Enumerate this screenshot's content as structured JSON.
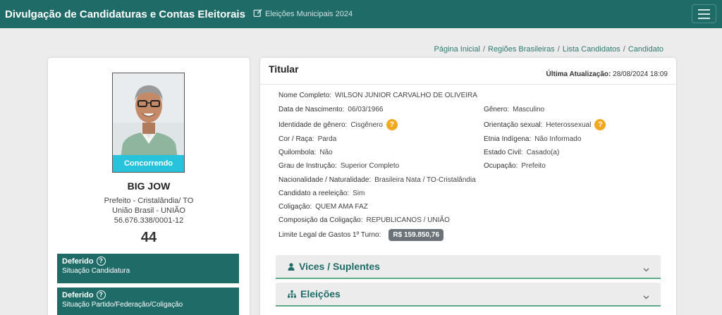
{
  "navbar": {
    "title": "Divulgação de Candidaturas e Contas Eleitorais",
    "election": "Eleições Municipais 2024",
    "edit_icon": "edit-icon",
    "menu_icon": "hamburger-icon"
  },
  "breadcrumb": [
    "Página Inicial",
    "Regiões Brasileiras",
    "Lista Candidatos",
    "Candidato"
  ],
  "candidate": {
    "photo_badge": "Concorrendo",
    "name": "BIG JOW",
    "office": "Prefeito - Cristalândia/ TO",
    "party": "União Brasil - UNIÃO",
    "cnpj": "56.676.338/0001-12",
    "number": "44",
    "statuses": [
      {
        "title": "Deferido",
        "desc": "Situação Candidatura"
      },
      {
        "title": "Deferido",
        "desc": "Situação Partido/Federação/Coligação"
      }
    ]
  },
  "details": {
    "title": "Titular",
    "updated_label": "Última Atualização:",
    "updated_value": "28/08/2024 18:09",
    "fields": {
      "nome": {
        "label": "Nome Completo:",
        "value": "WILSON JUNIOR CARVALHO DE OLIVEIRA"
      },
      "nascimento": {
        "label": "Data de Nascimento:",
        "value": "06/03/1966"
      },
      "genero": {
        "label": "Gênero:",
        "value": "Masculino"
      },
      "identidade": {
        "label": "Identidade de gênero:",
        "value": "Cisgênero"
      },
      "orientacao": {
        "label": "Orientação sexual:",
        "value": "Heterossexual"
      },
      "cor": {
        "label": "Cor / Raça:",
        "value": "Parda"
      },
      "etnia": {
        "label": "Etnia Indígena:",
        "value": "Não Informado"
      },
      "quilombola": {
        "label": "Quilombola:",
        "value": "Não"
      },
      "estado_civil": {
        "label": "Estado Civil:",
        "value": "Casado(a)"
      },
      "instrucao": {
        "label": "Grau de Instrução:",
        "value": "Superior Completo"
      },
      "ocupacao": {
        "label": "Ocupação:",
        "value": "Prefeito"
      },
      "nacionalidade": {
        "label": "Nacionalidade / Naturalidade:",
        "value": "Brasileira Nata / TO-Cristalândia"
      },
      "reeleicao": {
        "label": "Candidato a reeleição:",
        "value": "Sim"
      },
      "coligacao": {
        "label": "Coligação:",
        "value": "QUEM AMA FAZ"
      },
      "composicao": {
        "label": "Composição da Coligação:",
        "value": "REPUBLICANOS / UNIÃO"
      },
      "limite": {
        "label": "Limite Legal de Gastos 1º Turno:",
        "value": "R$ 159.850,76"
      }
    },
    "help_badge": "?"
  },
  "accordions": [
    {
      "label": "Vices / Suplentes",
      "icon": "person-icon"
    },
    {
      "label": "Eleições",
      "icon": "sitemap-icon"
    }
  ],
  "colors": {
    "primary": "#1f6b68",
    "concorrendo": "#27c3dc",
    "help_badge": "#f2a81d",
    "money_badge": "#6b7378",
    "accordion_border": "#5dab86"
  }
}
